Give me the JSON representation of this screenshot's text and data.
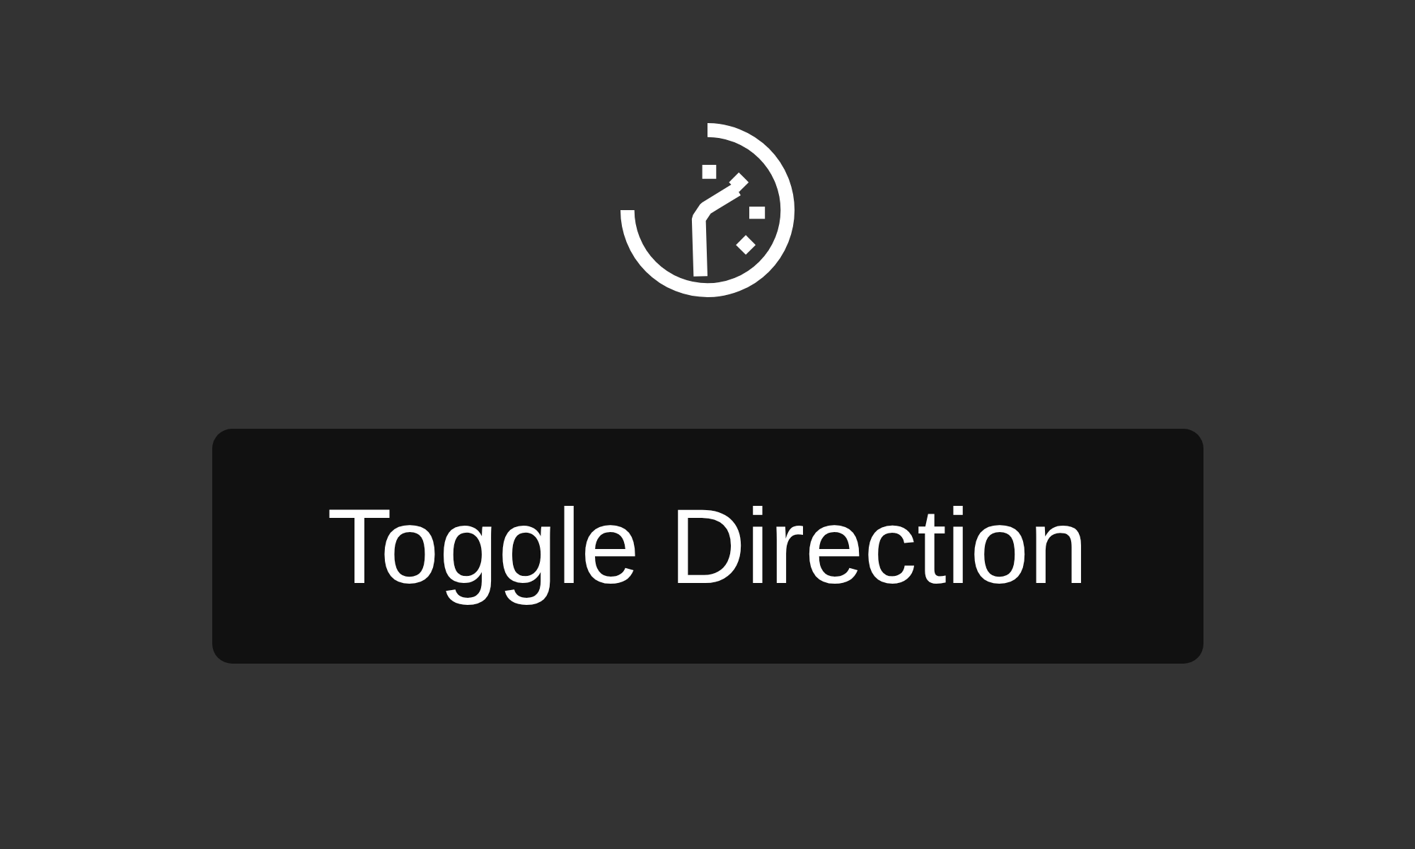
{
  "button": {
    "label": "Toggle Direction"
  }
}
